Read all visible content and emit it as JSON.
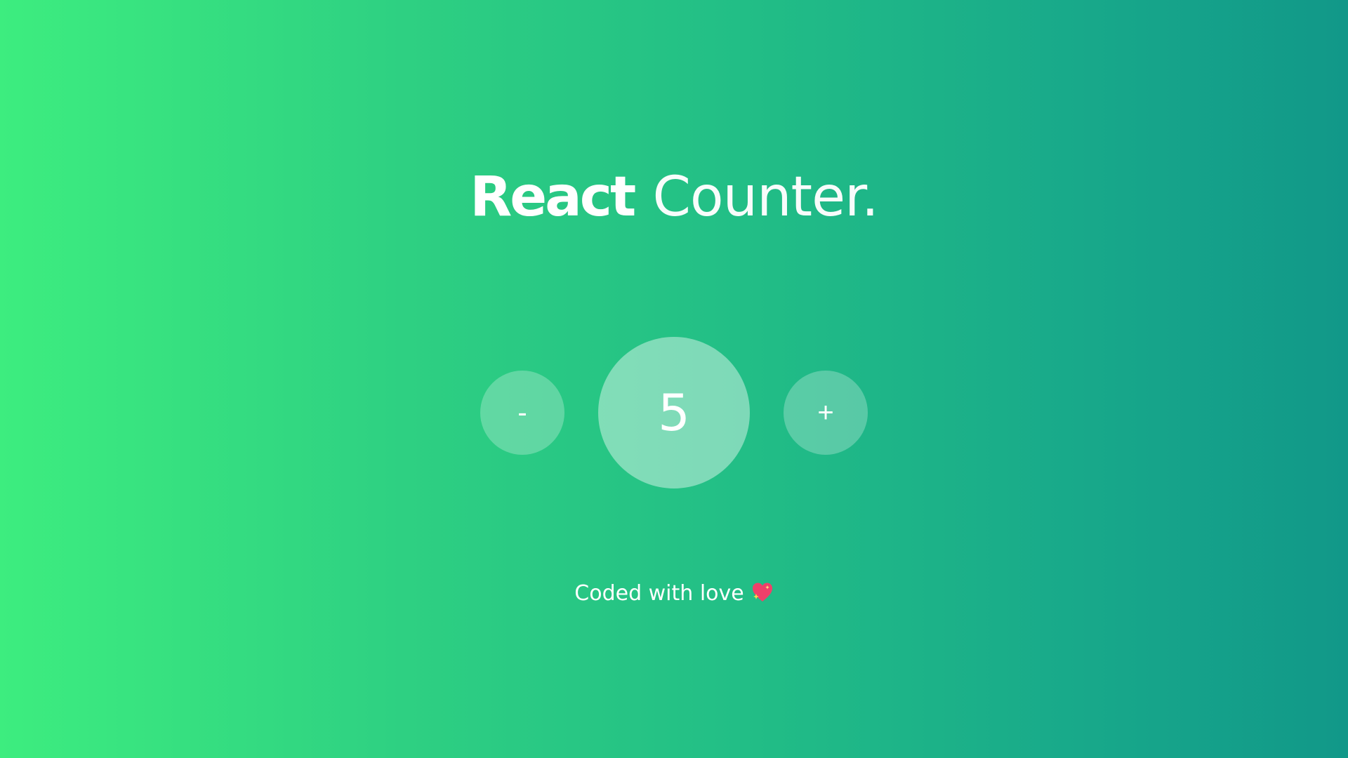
{
  "header": {
    "title_bold": "React",
    "title_light": "Counter."
  },
  "counter": {
    "decrement_label": "-",
    "value": "5",
    "increment_label": "+"
  },
  "footer": {
    "text": "Coded with love",
    "icon": "sparkling-heart-icon"
  },
  "colors": {
    "gradient_start": "#3ded7f",
    "gradient_end": "#119889",
    "text": "#ffffff",
    "heart": "#f0406a"
  }
}
